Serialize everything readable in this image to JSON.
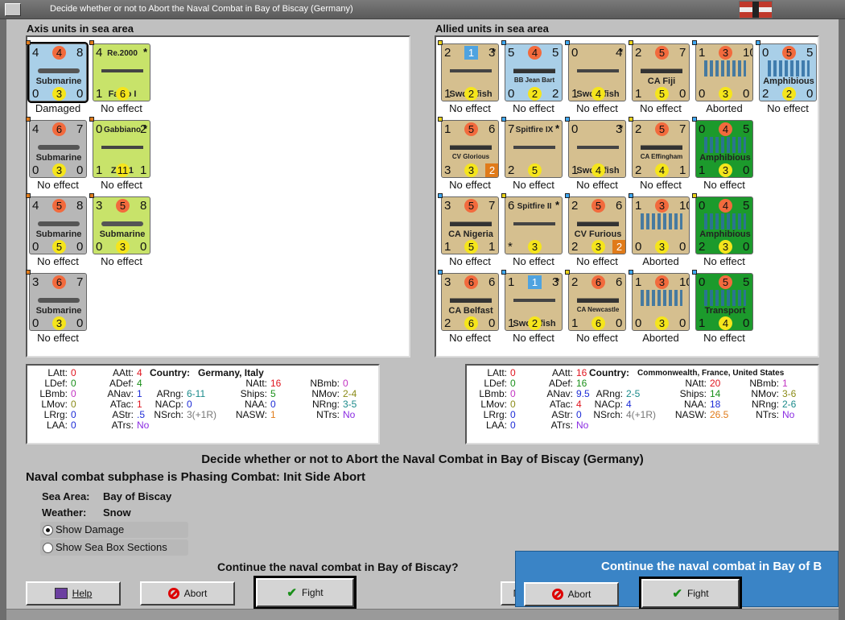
{
  "window": {
    "title": "Decide whether or not to Abort the Naval Combat in Bay of Biscay (Germany)"
  },
  "axis": {
    "header": "Axis units in sea area",
    "units": [
      {
        "kind": "sub",
        "bg": "#a9cfe8",
        "tl": "4",
        "tc": "4",
        "tr": "8",
        "name": "Submarine",
        "bl": "0",
        "bc": "3",
        "br": "0",
        "result": "Damaged",
        "selected": true
      },
      {
        "kind": "air",
        "bg": "#c8e36a",
        "tl": "4",
        "title": "Re.2000",
        "name": "Falco I",
        "bl": "1",
        "bc": "6",
        "result": "No effect"
      },
      {
        "kind": "sub",
        "bg": "#b7b7b7",
        "tl": "4",
        "tc": "6",
        "tr": "7",
        "name": "Submarine",
        "bl": "0",
        "bc": "3",
        "br": "0",
        "result": "No effect"
      },
      {
        "kind": "air",
        "bg": "#c8e36a",
        "tl": "0",
        "title": "Gabbiano",
        "tr": "2",
        "name": "Z.501",
        "bl": "1",
        "bc": "11",
        "br": "1",
        "result": "No effect"
      },
      {
        "kind": "sub",
        "bg": "#b7b7b7",
        "tl": "4",
        "tc": "5",
        "tr": "8",
        "name": "Submarine",
        "bl": "0",
        "bc": "5",
        "br": "0",
        "result": "No effect"
      },
      {
        "kind": "sub",
        "bg": "#c8e36a",
        "tl": "3",
        "tc": "5",
        "tr": "8",
        "name": "Submarine",
        "bl": "0",
        "bc": "3",
        "br": "0",
        "result": "No effect"
      },
      {
        "kind": "sub",
        "bg": "#b7b7b7",
        "tl": "3",
        "tc": "6",
        "tr": "7",
        "name": "Submarine",
        "bl": "0",
        "bc": "3",
        "br": "0",
        "result": "No effect"
      }
    ],
    "stats": {
      "latt": "0",
      "ldef": "0",
      "lbmb": "0",
      "lmov": "0",
      "lrng": "0",
      "laa": "0",
      "aatt": "4",
      "adef": "4",
      "anav": "1",
      "atac": "1",
      "astr": ".5",
      "atrs": "No",
      "country_label": "Country:",
      "country": "Germany, Italy",
      "arng": "6-11",
      "nacp": "0",
      "nsrch": "3(+1R)",
      "natt": "16",
      "ships": "5",
      "naa": "0",
      "nasw": "1",
      "nbmb": "0",
      "nmov": "2-4",
      "nrng": "3-5",
      "ntrs": "No"
    }
  },
  "allied": {
    "header": "Allied units in sea area",
    "units": [
      {
        "kind": "air",
        "bg": "#d5bf8f",
        "tl": "2",
        "tc": "1",
        "tr": "3",
        "name": "Swordfish",
        "bl": "1",
        "bc": "2",
        "result": "No effect"
      },
      {
        "kind": "ship",
        "bg": "#a9cfe8",
        "tl": "5",
        "tc": "4",
        "tr": "5",
        "name": "BB Jean Bart",
        "bl": "0",
        "bc": "2",
        "br": "2",
        "result": "No effect"
      },
      {
        "kind": "air",
        "bg": "#d5bf8f",
        "tl": "0",
        "tr": "4",
        "name": "Swordfish",
        "bl": "1",
        "bc": "4",
        "result": "No effect"
      },
      {
        "kind": "ship",
        "bg": "#d5bf8f",
        "tl": "2",
        "tc": "5",
        "tr": "7",
        "name": "CA Fiji",
        "bl": "1",
        "bc": "5",
        "br": "0",
        "result": "No effect"
      },
      {
        "kind": "conv",
        "bg": "#d5bf8f",
        "tl": "1",
        "tc": "3",
        "tr": "10",
        "name": "",
        "bl": "0",
        "bc": "3",
        "br": "0",
        "result": "Aborted"
      },
      {
        "kind": "amph",
        "bg": "#a9cfe8",
        "tl": "0",
        "tc": "5",
        "tr": "5",
        "name": "Amphibious",
        "bl": "2",
        "bc": "2",
        "br": "0",
        "result": "No effect"
      },
      {
        "kind": "ship",
        "bg": "#d5bf8f",
        "tl": "1",
        "tc": "5",
        "tr": "6",
        "name": "CV Glorious",
        "bl": "3",
        "bc": "3",
        "br": "2",
        "result": "No effect"
      },
      {
        "kind": "air",
        "bg": "#d5bf8f",
        "tl": "7",
        "title": "Spitfire IX",
        "name": "",
        "bl": "2",
        "bc": "5",
        "result": "No effect"
      },
      {
        "kind": "air",
        "bg": "#d5bf8f",
        "tl": "0",
        "tr": "3",
        "name": "Swordfish",
        "bl": "1",
        "bc": "4",
        "result": "No effect"
      },
      {
        "kind": "ship",
        "bg": "#d5bf8f",
        "tl": "2",
        "tc": "5",
        "tr": "7",
        "name": "CA Effingham",
        "bl": "2",
        "bc": "4",
        "br": "1",
        "result": "No effect"
      },
      {
        "kind": "amph",
        "bg": "#1c9a2c",
        "tl": "0",
        "tc": "4",
        "tr": "5",
        "name": "Amphibious",
        "bl": "1",
        "bc": "3",
        "br": "0",
        "result": "No effect"
      },
      {
        "kind": "ship",
        "bg": "#d5bf8f",
        "tl": "3",
        "tc": "5",
        "tr": "7",
        "name": "CA Nigeria",
        "bl": "1",
        "bc": "5",
        "br": "1",
        "result": "No effect"
      },
      {
        "kind": "air",
        "bg": "#d5bf8f",
        "tl": "6",
        "title": "Spitfire II",
        "name": "",
        "bl": "*",
        "bc": "3",
        "result": "No effect"
      },
      {
        "kind": "ship",
        "bg": "#d5bf8f",
        "tl": "2",
        "tc": "5",
        "tr": "6",
        "name": "CV Furious",
        "bl": "2",
        "bc": "3",
        "br": "2",
        "result": "No effect"
      },
      {
        "kind": "conv",
        "bg": "#d5bf8f",
        "tl": "1",
        "tc": "3",
        "tr": "10",
        "name": "",
        "bl": "0",
        "bc": "3",
        "br": "0",
        "result": "Aborted"
      },
      {
        "kind": "amph",
        "bg": "#1c9a2c",
        "tl": "0",
        "tc": "4",
        "tr": "5",
        "name": "Amphibious",
        "bl": "2",
        "bc": "3",
        "br": "0",
        "result": "No effect"
      },
      {
        "kind": "ship",
        "bg": "#d5bf8f",
        "tl": "3",
        "tc": "6",
        "tr": "6",
        "name": "CA Belfast",
        "bl": "2",
        "bc": "6",
        "br": "0",
        "result": "No effect"
      },
      {
        "kind": "air",
        "bg": "#d5bf8f",
        "tl": "1",
        "tc": "1",
        "tr": "3",
        "name": "Swordfish",
        "bl": "1",
        "bc": "2",
        "result": "No effect"
      },
      {
        "kind": "ship",
        "bg": "#d5bf8f",
        "tl": "2",
        "tc": "6",
        "tr": "6",
        "name": "CA Newcastle",
        "bl": "1",
        "bc": "6",
        "br": "0",
        "result": "No effect"
      },
      {
        "kind": "conv",
        "bg": "#d5bf8f",
        "tl": "1",
        "tc": "3",
        "tr": "10",
        "name": "",
        "bl": "0",
        "bc": "3",
        "br": "0",
        "result": "Aborted"
      },
      {
        "kind": "amph",
        "bg": "#1c9a2c",
        "tl": "0",
        "tc": "5",
        "tr": "5",
        "name": "Transport",
        "bl": "1",
        "bc": "4",
        "br": "0",
        "result": "No effect"
      }
    ],
    "stats": {
      "latt": "0",
      "ldef": "0",
      "lbmb": "0",
      "lmov": "0",
      "lrng": "0",
      "laa": "0",
      "aatt": "16",
      "adef": "16",
      "anav": "9.5",
      "atac": "4",
      "astr": "0",
      "atrs": "No",
      "country_label": "Country:",
      "country": "Commonwealth, France, United States",
      "arng": "2-5",
      "nacp": "4",
      "nsrch": "4(+1R)",
      "natt": "20",
      "ships": "14",
      "naa": "18",
      "nasw": "26.5",
      "nbmb": "1",
      "nmov": "3-6",
      "nrng": "2-6",
      "ntrs": "No"
    }
  },
  "labels": {
    "latt": "LAtt:",
    "ldef": "LDef:",
    "lbmb": "LBmb:",
    "lmov": "LMov:",
    "lrng": "LRrg:",
    "laa": "LAA:",
    "aatt": "AAtt:",
    "adef": "ADef:",
    "anav": "ANav:",
    "atac": "ATac:",
    "astr": "AStr:",
    "atrs": "ATrs:",
    "arng": "ARng:",
    "nacp": "NACp:",
    "nsrch": "NSrch:",
    "natt": "NAtt:",
    "ships": "Ships:",
    "naa": "NAA:",
    "nasw": "NASW:",
    "nbmb": "NBmb:",
    "nmov": "NMov:",
    "nrng": "NRng:",
    "ntrs": "NTrs:"
  },
  "info": {
    "heading": "Decide whether or not to Abort the Naval Combat in Bay of Biscay (Germany)",
    "subphase": "Naval combat subphase is Phasing Combat: Init Side Abort",
    "sea_area_label": "Sea Area:",
    "sea_area": "Bay of Biscay",
    "weather_label": "Weather:",
    "weather": "Snow",
    "show_damage": "Show Damage",
    "show_sections": "Show Sea Box Sections",
    "question": "Continue the naval combat in Bay of Biscay?"
  },
  "buttons": {
    "help": "Help",
    "abort": "Abort",
    "fight": "Fight",
    "no": "N"
  },
  "popup": {
    "text": "Continue the naval combat in Bay of B",
    "abort": "Abort",
    "fight": "Fight"
  },
  "colors": {
    "attack": "#f26a3d",
    "defense": "#f5e51c",
    "damaged": "#4fa3e0"
  }
}
